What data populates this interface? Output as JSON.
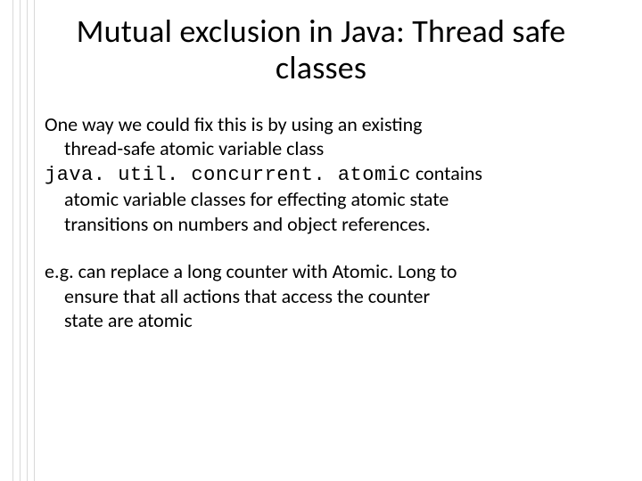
{
  "title": "Mutual exclusion in Java: Thread safe classes",
  "para1": {
    "line1": "One way we could fix this is by using an existing",
    "line2": "thread-safe atomic variable class"
  },
  "para2": {
    "code": "java. util. concurrent. atomic",
    "line1_rest": " contains",
    "line2": "atomic variable classes for effecting atomic state",
    "line3": "transitions on numbers and object references."
  },
  "para3": {
    "line1": "e.g. can replace a long counter with Atomic. Long to",
    "line2": "ensure that all actions that access the counter",
    "line3": "state are atomic"
  }
}
